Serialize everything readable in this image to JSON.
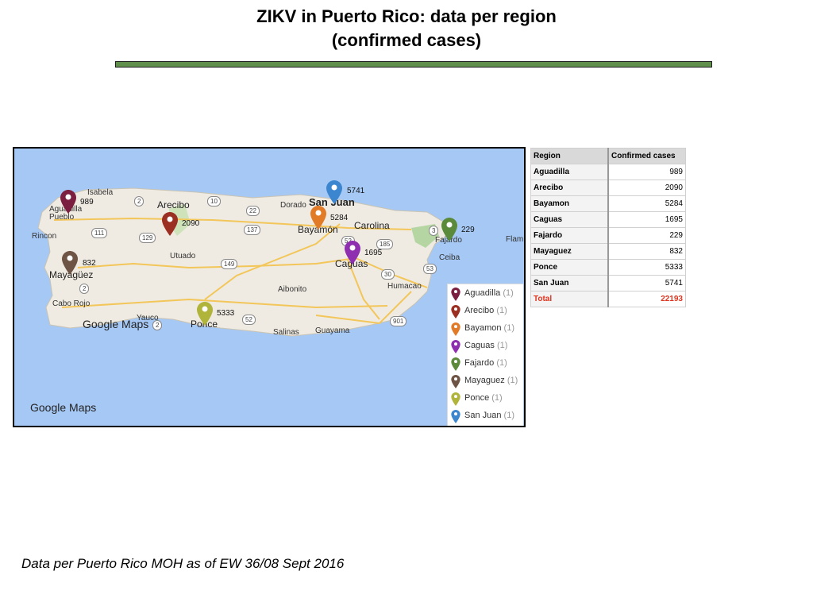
{
  "title": {
    "line1": "ZIKV in Puerto Rico: data per region",
    "line2": "(confirmed cases)"
  },
  "map": {
    "watermark_inner": "Google Maps",
    "watermark_corner": "Google Maps",
    "places": [
      "Isabela",
      "Arecibo",
      "Dorado",
      "San Juan",
      "Carolina",
      "Bayamón",
      "Fajardo",
      "Flam",
      "Aguadilla Pueblo",
      "Rincon",
      "Utuado",
      "Caguas",
      "Ceiba",
      "Mayagüez",
      "Aibonito",
      "Humacao",
      "Cabo Rojo",
      "Yauco",
      "Ponce",
      "Salinas",
      "Guayama"
    ],
    "routes": [
      "2",
      "10",
      "22",
      "137",
      "111",
      "129",
      "149",
      "52",
      "185",
      "3",
      "53",
      "30",
      "52",
      "901",
      "2",
      "2"
    ],
    "markers": [
      {
        "region": "Aguadilla",
        "value": "989",
        "color": "#7b1e3f"
      },
      {
        "region": "Arecibo",
        "value": "2090",
        "color": "#9a2f22"
      },
      {
        "region": "Bayamon",
        "value": "5284",
        "color": "#e17b28"
      },
      {
        "region": "Caguas",
        "value": "1695",
        "color": "#8e2fb0"
      },
      {
        "region": "Fajardo",
        "value": "229",
        "color": "#5a8a3a"
      },
      {
        "region": "Mayaguez",
        "value": "832",
        "color": "#6e5444"
      },
      {
        "region": "Ponce",
        "value": "5333",
        "color": "#b0b43a"
      },
      {
        "region": "San Juan",
        "value": "5741",
        "color": "#3b86cf"
      }
    ],
    "legend": [
      {
        "name": "Aguadilla",
        "count": "(1)",
        "color": "#7b1e3f"
      },
      {
        "name": "Arecibo",
        "count": "(1)",
        "color": "#9a2f22"
      },
      {
        "name": "Bayamon",
        "count": "(1)",
        "color": "#e17b28"
      },
      {
        "name": "Caguas",
        "count": "(1)",
        "color": "#8e2fb0"
      },
      {
        "name": "Fajardo",
        "count": "(1)",
        "color": "#5a8a3a"
      },
      {
        "name": "Mayaguez",
        "count": "(1)",
        "color": "#6e5444"
      },
      {
        "name": "Ponce",
        "count": "(1)",
        "color": "#b0b43a"
      },
      {
        "name": "San Juan",
        "count": "(1)",
        "color": "#3b86cf"
      }
    ]
  },
  "table": {
    "header": [
      "Region",
      "Confirmed cases"
    ],
    "rows": [
      [
        "Aguadilla",
        "989"
      ],
      [
        "Arecibo",
        "2090"
      ],
      [
        "Bayamon",
        "5284"
      ],
      [
        "Caguas",
        "1695"
      ],
      [
        "Fajardo",
        "229"
      ],
      [
        "Mayaguez",
        "832"
      ],
      [
        "Ponce",
        "5333"
      ],
      [
        "San Juan",
        "5741"
      ]
    ],
    "total": [
      "Total",
      "22193"
    ]
  },
  "footnote": "Data per Puerto Rico MOH as of EW 36/08 Sept 2016",
  "colors": {
    "rule": "#5f8f4a",
    "water": "#a6c8f4",
    "land": "#efebe2",
    "total": "#e0331e"
  }
}
